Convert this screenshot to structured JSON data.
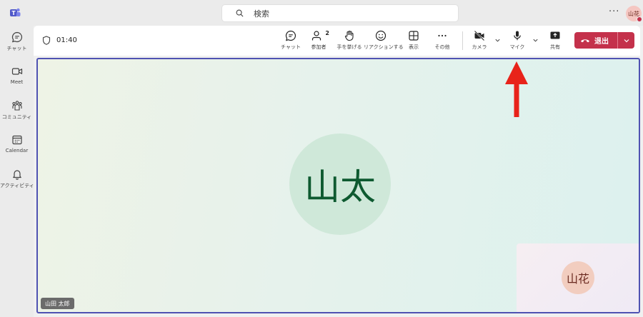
{
  "search": {
    "placeholder": "検索"
  },
  "user": {
    "initials": "山花"
  },
  "rail": {
    "items": [
      {
        "label": "チャット",
        "icon": "chat-icon"
      },
      {
        "label": "Meet",
        "icon": "video-icon"
      },
      {
        "label": "コミュニティ",
        "icon": "community-icon"
      },
      {
        "label": "Calendar",
        "icon": "calendar-icon"
      },
      {
        "label": "アクティビティ",
        "icon": "bell-icon"
      }
    ]
  },
  "meeting": {
    "timer": "01:40",
    "participant_count": "2",
    "toolbar": {
      "chat": "チャット",
      "participants": "参加者",
      "raise_hand": "手を挙げる",
      "react": "リアクションする",
      "view": "表示",
      "more": "その他",
      "camera": "カメラ",
      "mic": "マイク",
      "share": "共有",
      "leave": "退出"
    },
    "main_participant": {
      "initials": "山太",
      "name": "山田 太郎"
    },
    "self_view": {
      "initials": "山花"
    }
  },
  "colors": {
    "accent": "#4f52b2",
    "leave": "#c4314b",
    "annotation_arrow": "#e8231a"
  }
}
